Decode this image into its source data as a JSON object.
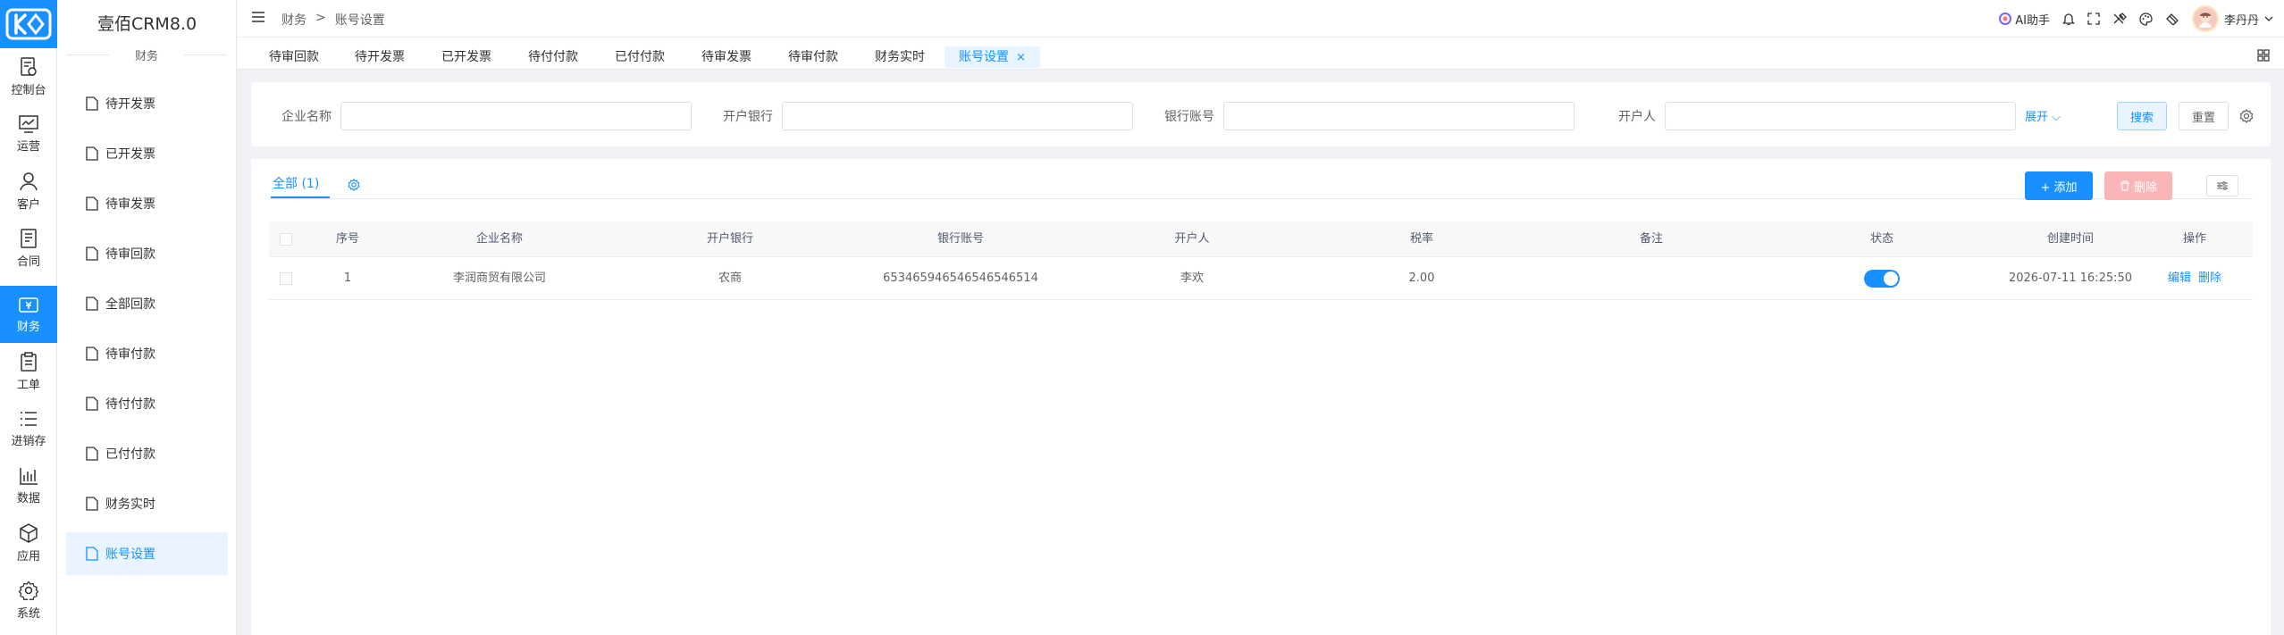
{
  "rail": {
    "items": [
      {
        "label": "控制台",
        "icon": "dashboard-doc-icon"
      },
      {
        "label": "运营",
        "icon": "chart-line-icon"
      },
      {
        "label": "客户",
        "icon": "user-icon"
      },
      {
        "label": "合同",
        "icon": "contract-icon"
      },
      {
        "label": "财务",
        "icon": "finance-icon"
      },
      {
        "label": "工单",
        "icon": "clipboard-icon"
      },
      {
        "label": "进销存",
        "icon": "list-icon"
      },
      {
        "label": "数据",
        "icon": "bar-chart-icon"
      },
      {
        "label": "应用",
        "icon": "cube-icon"
      },
      {
        "label": "系统",
        "icon": "gear-icon"
      }
    ]
  },
  "sub": {
    "brand": "壹佰CRM8.0",
    "section": "财务",
    "items": [
      {
        "label": "待开发票"
      },
      {
        "label": "已开发票"
      },
      {
        "label": "待审发票"
      },
      {
        "label": "待审回款"
      },
      {
        "label": "全部回款"
      },
      {
        "label": "待审付款"
      },
      {
        "label": "待付付款"
      },
      {
        "label": "已付付款"
      },
      {
        "label": "财务实时"
      },
      {
        "label": "账号设置"
      }
    ]
  },
  "topbar": {
    "breadcrumb": [
      "财务",
      ">",
      "账号设置"
    ],
    "ai_label": "AI助手",
    "user_name": "李丹丹"
  },
  "tabs": [
    {
      "label": "待审回款"
    },
    {
      "label": "待开发票"
    },
    {
      "label": "已开发票"
    },
    {
      "label": "待付付款"
    },
    {
      "label": "已付付款"
    },
    {
      "label": "待审发票"
    },
    {
      "label": "待审付款"
    },
    {
      "label": "财务实时"
    },
    {
      "label": "账号设置",
      "close": "×"
    }
  ],
  "filter": {
    "company_label": "企业名称",
    "bank_label": "开户银行",
    "account_label": "银行账号",
    "holder_label": "开户人",
    "expand_label": "展开",
    "search_label": "搜索",
    "reset_label": "重置"
  },
  "list": {
    "tab_all": "全部 (1)",
    "add_label": "+ 添加",
    "delete_label": "删除",
    "columns": [
      "序号",
      "企业名称",
      "开户银行",
      "银行账号",
      "开户人",
      "税率",
      "备注",
      "状态",
      "创建时间",
      "操作"
    ],
    "rows": [
      {
        "index": "1",
        "company": "李润商贸有限公司",
        "bank": "农商",
        "account": "653465946546546546514",
        "holder": "李欢",
        "tax_rate": "2.00",
        "remark": "",
        "status_on": true,
        "created": "2026-07-11 16:25:50",
        "edit": "编辑",
        "delete": "删除"
      }
    ]
  },
  "colors": {
    "primary": "#1890ff",
    "danger_disabled": "#fab6b6",
    "active_bg": "#e8f4ff"
  }
}
